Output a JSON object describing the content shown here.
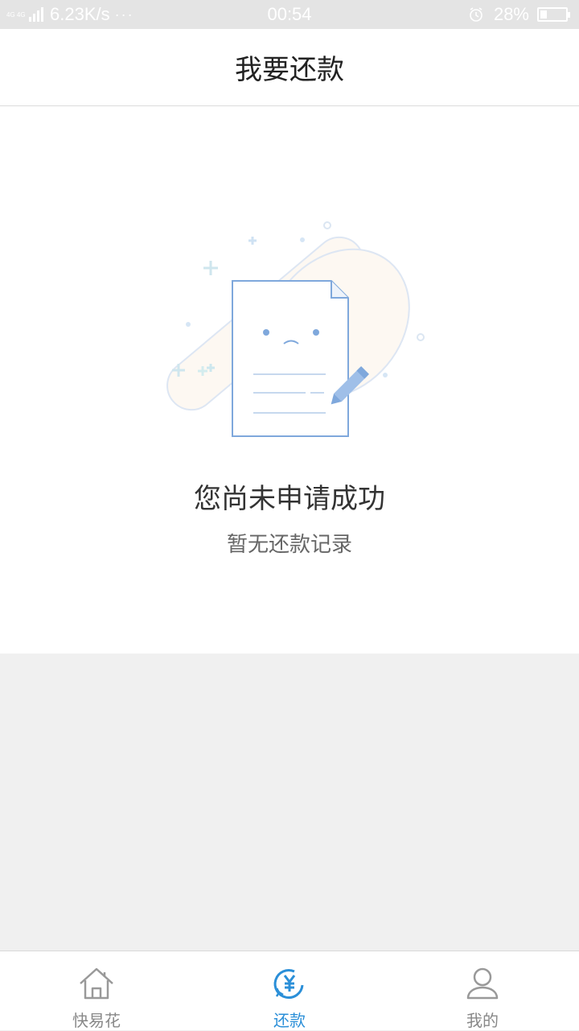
{
  "status_bar": {
    "network_tiny": "4G 4G",
    "speed": "6.23K/s",
    "dots": "···",
    "time": "00:54",
    "battery_percent": "28%",
    "battery_level": 0.28
  },
  "header": {
    "title": "我要还款"
  },
  "empty_state": {
    "title": "您尚未申请成功",
    "subtitle": "暂无还款记录",
    "illustration_icon": "document-sad-face-pencil"
  },
  "tabbar": {
    "tabs": [
      {
        "label": "快易花",
        "icon": "home-icon",
        "active": false
      },
      {
        "label": "还款",
        "icon": "yen-repay-icon",
        "active": true
      },
      {
        "label": "我的",
        "icon": "user-icon",
        "active": false
      }
    ]
  },
  "colors": {
    "accent": "#2b8fd8",
    "inactive": "#888888",
    "page_background": "#f0f0f0",
    "illustration_line": "#7fa8dc"
  }
}
